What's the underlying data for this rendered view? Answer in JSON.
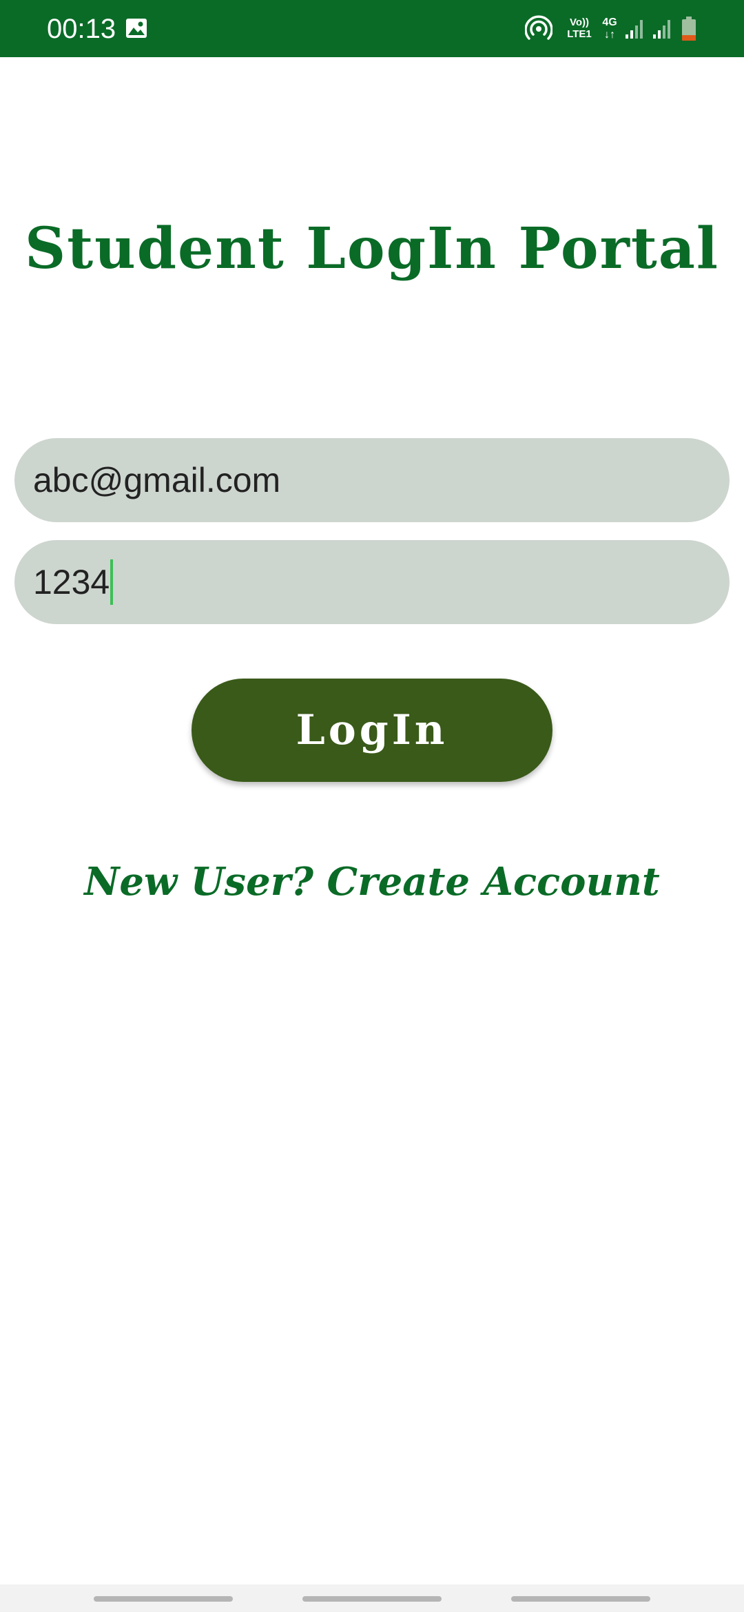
{
  "status_bar": {
    "time": "00:13",
    "volte_line1": "Vo))",
    "volte_line2": "LTE1",
    "network_type": "4G",
    "network_arrows": "↓↑",
    "background_color": "#0a6b27",
    "icons": [
      "gallery-icon",
      "hotspot-icon",
      "signal-icon",
      "signal-icon",
      "battery-icon"
    ]
  },
  "title": "Student LogIn Portal",
  "form": {
    "email_value": "abc@gmail.com",
    "password_value": "1234",
    "field_color": "#cdd5cf",
    "caret_color": "#3dbf55"
  },
  "login_button": {
    "label": "LogIn",
    "color": "#3a5a19"
  },
  "create_account_link": "New User? Create Account",
  "colors": {
    "brand_green": "#0a6b27",
    "battery_low": "#e05a1a"
  },
  "navigation_bar": {
    "buttons": [
      "nav-recents",
      "nav-home",
      "nav-back"
    ]
  }
}
